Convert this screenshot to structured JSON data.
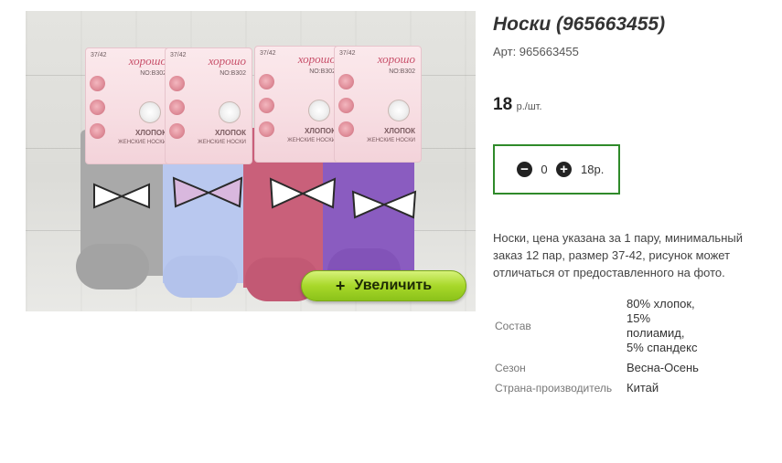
{
  "product": {
    "title": "Носки (965663455)",
    "sku": "Арт: 965663455",
    "price": "18",
    "price_unit": "р./шт.",
    "description": "Носки, цена указана за 1 пару, минимальный заказ 12 пар, размер 37-42, рисунок может отличаться от предоставленного на фото."
  },
  "image": {
    "zoom_label": "Увеличить",
    "zoom_icon": "plus-icon",
    "package_brand": "хорошо",
    "package_size": "37/42",
    "package_no": "NO:B302",
    "package_material": "ХЛОПОК",
    "package_sub": "ЖЕНСКИЕ НОСКИ",
    "sock_colors": [
      "#a9a9a9",
      "#b9c8ef",
      "#c9607a",
      "#8a5cc0"
    ]
  },
  "cart": {
    "minus_icon": "minus-circle-icon",
    "plus_icon": "plus-circle-icon",
    "minus_symbol": "−",
    "plus_symbol": "+",
    "quantity": "0",
    "sum": "18р.",
    "border_color": "#2f8a2a"
  },
  "properties": [
    {
      "name": "Состав",
      "value": "80% хлопок, 15% полиамид, 5% спандекс"
    },
    {
      "name": "Сезон",
      "value": "Весна-Осень"
    },
    {
      "name": "Страна-производитель",
      "value": "Китай"
    }
  ]
}
